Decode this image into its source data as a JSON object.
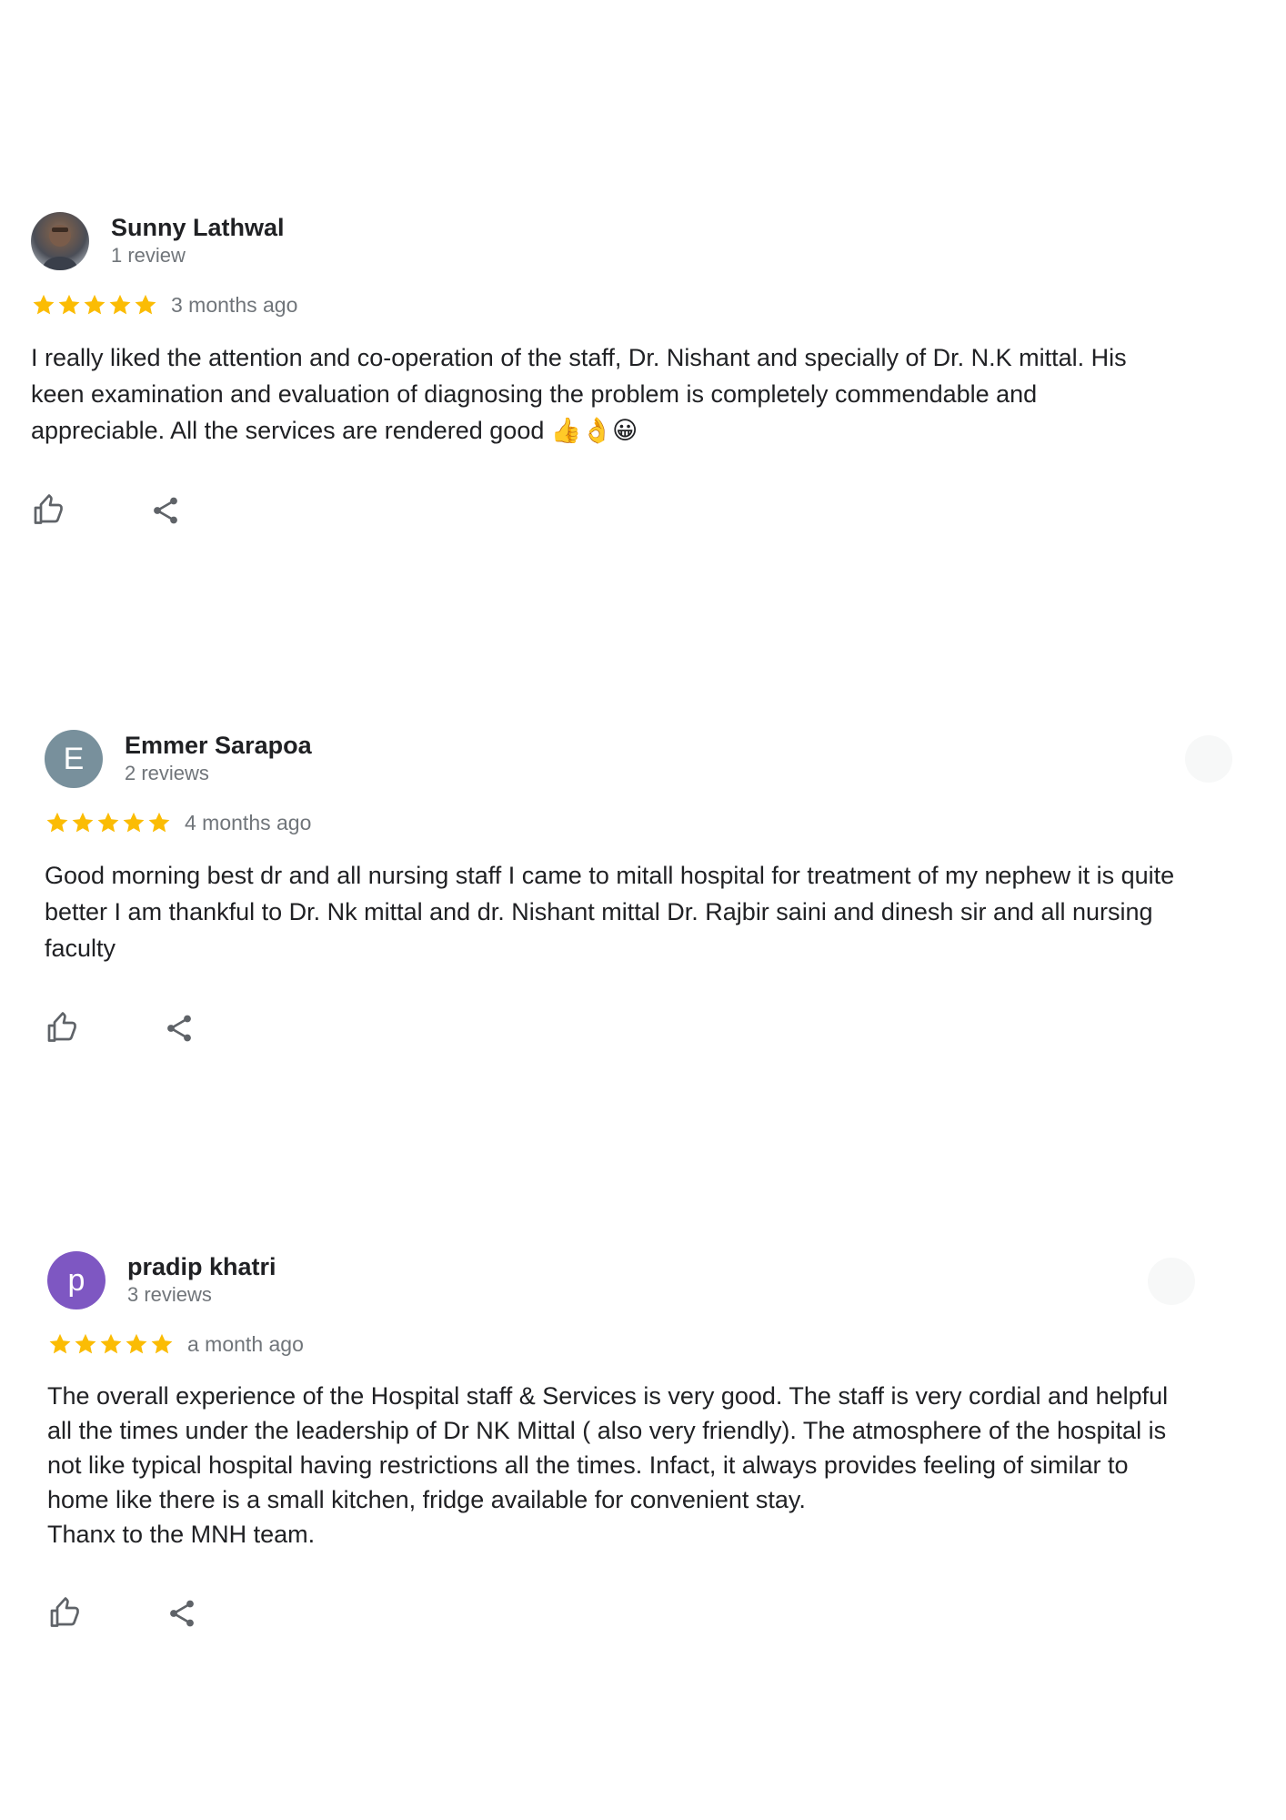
{
  "reviews": [
    {
      "name": "Sunny Lathwal",
      "count": "1 review",
      "avatar": {
        "type": "photo",
        "letter": ""
      },
      "rating": 5,
      "time": "3 months ago",
      "text": "I really liked the attention and co-operation of the staff, Dr. Nishant and specially of Dr. N.K mittal. His\nkeen examination and evaluation of diagnosing the problem is completely commendable and\nappreciable. All the services are rendered good 👍👌😀"
    },
    {
      "name": "Emmer Sarapoa",
      "count": "2 reviews",
      "avatar": {
        "type": "letter",
        "letter": "E",
        "color": "#78909c"
      },
      "rating": 5,
      "time": "4 months ago",
      "text": "Good morning best dr and all nursing staff I came to mitall hospital for treatment of my nephew it is quite\nbetter I am thankful to Dr. Nk mittal and dr. Nishant mittal Dr. Rajbir saini and dinesh sir and all nursing\nfaculty"
    },
    {
      "name": "pradip khatri",
      "count": "3 reviews",
      "avatar": {
        "type": "letter",
        "letter": "p",
        "color": "#7e57c2"
      },
      "rating": 5,
      "time": "a month ago",
      "text": "The overall experience of the Hospital staff & Services is very good. The staff is very cordial and helpful\nall the times under the leadership of Dr NK Mittal ( also very friendly). The atmosphere of the hospital is\nnot like typical hospital having restrictions all the times. Infact, it always provides feeling of similar to\nhome like there is a small kitchen, fridge available for convenient stay.\nThanx to the MNH team."
    }
  ],
  "icons": {
    "star": "star-icon",
    "like": "thumb-up-icon",
    "share": "share-icon"
  },
  "colors": {
    "star": "#fbbc04",
    "name": "#202124",
    "secondary": "#70757a",
    "icon": "#5f6368"
  }
}
